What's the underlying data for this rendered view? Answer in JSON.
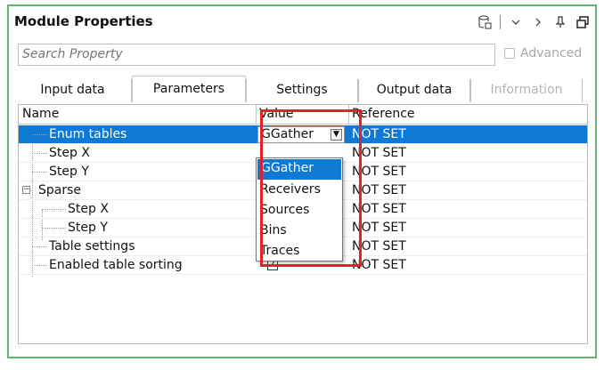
{
  "panel": {
    "title": "Module Properties",
    "accent_color": "#62b874",
    "title_icons": [
      "database-icon",
      "chevron-down-icon",
      "chevron-right-icon",
      "pin-icon",
      "restore-window-icon"
    ]
  },
  "search": {
    "placeholder": "Search Property"
  },
  "advanced": {
    "label": "Advanced",
    "checked": false
  },
  "tabs": [
    {
      "label": "Input data",
      "active": false,
      "enabled": true
    },
    {
      "label": "Parameters",
      "active": true,
      "enabled": true
    },
    {
      "label": "Settings",
      "active": false,
      "enabled": true
    },
    {
      "label": "Output data",
      "active": false,
      "enabled": true
    },
    {
      "label": "Information",
      "active": false,
      "enabled": false
    }
  ],
  "grid": {
    "columns": [
      "Name",
      "Value",
      "Reference"
    ],
    "rows": [
      {
        "name": "Enum tables",
        "value": "GGather",
        "reference": "NOT SET",
        "selected": true
      },
      {
        "name": "Step X",
        "reference": "NOT SET"
      },
      {
        "name": "Step Y",
        "reference": "NOT SET"
      },
      {
        "name": "Sparse",
        "reference": "NOT SET",
        "expanded": true
      },
      {
        "name": "Step X",
        "reference": "NOT SET"
      },
      {
        "name": "Step Y",
        "reference": "NOT SET"
      },
      {
        "name": "Table settings",
        "reference": "NOT SET"
      },
      {
        "name": "Enabled table sorting",
        "reference": "NOT SET",
        "value_checked": true
      }
    ]
  },
  "dropdown": {
    "options": [
      "GGather",
      "Receivers",
      "Sources",
      "Bins",
      "Traces"
    ],
    "selected": "GGather"
  },
  "colors": {
    "selection": "#0f7ad6",
    "highlight_box": "#e3212b"
  }
}
